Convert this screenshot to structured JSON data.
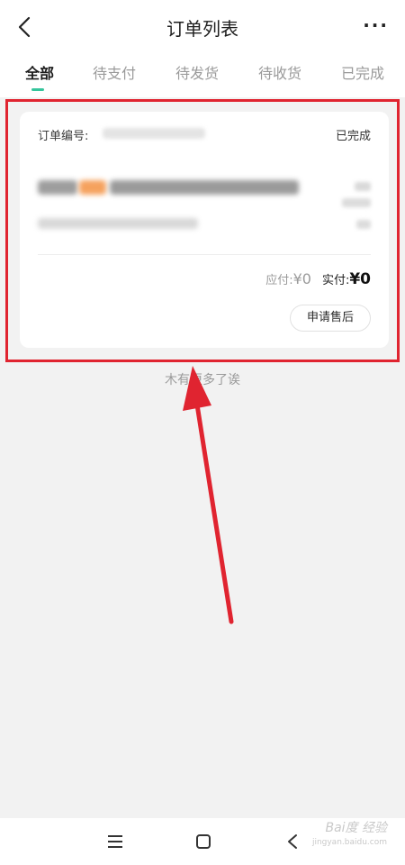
{
  "header": {
    "title": "订单列表",
    "more": "···"
  },
  "tabs": [
    {
      "label": "全部",
      "active": true
    },
    {
      "label": "待支付"
    },
    {
      "label": "待发货"
    },
    {
      "label": "待收货"
    },
    {
      "label": "已完成"
    }
  ],
  "order": {
    "number_label": "订单编号:",
    "status": "已完成",
    "payable_label": "应付:",
    "payable_value": "¥0",
    "paid_label": "实付:",
    "paid_value": "¥0",
    "after_sale_button": "申请售后"
  },
  "list_footer": "木有更多了诶",
  "watermark": {
    "text": "Bai度 经验",
    "sub": "jingyan.baidu.com"
  },
  "colors": {
    "accent": "#36c59c",
    "annotation": "#e02430"
  },
  "icons": [
    "back-arrow-icon",
    "more-dots-icon",
    "menu-icon",
    "home-icon",
    "nav-back-icon"
  ]
}
